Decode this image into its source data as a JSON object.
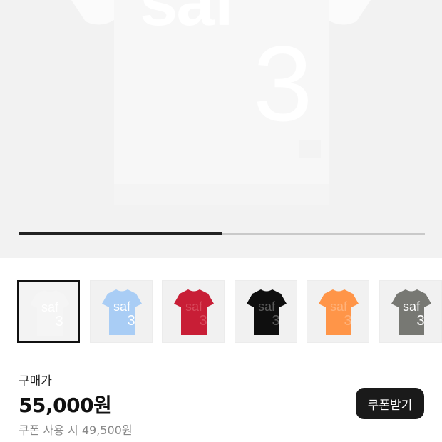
{
  "product_image": {
    "print_letters": "saf",
    "print_number": "3"
  },
  "gallery": {
    "progress": 0.5
  },
  "swatches": [
    {
      "color": "#f5f5f5",
      "text_color": "#ffffff",
      "letters": "saf",
      "number": "3",
      "selected": true
    },
    {
      "color": "#a9cdf5",
      "text_color": "#ffffff",
      "letters": "saf",
      "number": "3",
      "selected": false
    },
    {
      "color": "#c81e36",
      "text_color": "#d84a5c",
      "letters": "saf",
      "number": "3",
      "selected": false
    },
    {
      "color": "#0f0f0f",
      "text_color": "#5a5a5a",
      "letters": "saf",
      "number": "3",
      "selected": false
    },
    {
      "color": "#ff9548",
      "text_color": "#ffb27a",
      "letters": "saf",
      "number": "3",
      "selected": false
    },
    {
      "color": "#777873",
      "text_color": "#ffffff",
      "letters": "saf",
      "number": "3",
      "selected": false
    }
  ],
  "purchase": {
    "label": "구매가",
    "price": "55,000원",
    "coupon_price": "쿠폰 사용 시 49,500원",
    "coupon_button": "쿠폰받기"
  }
}
